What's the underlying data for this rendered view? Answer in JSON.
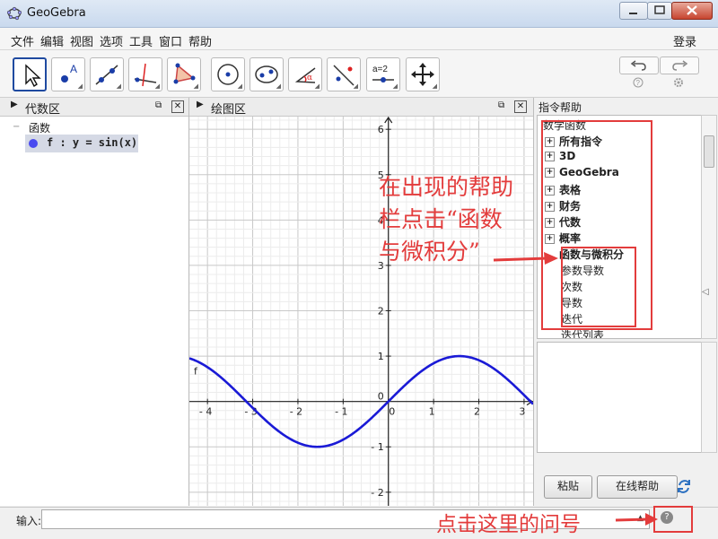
{
  "window": {
    "title": "GeoGebra"
  },
  "menu": [
    "文件",
    "编辑",
    "视图",
    "选项",
    "工具",
    "窗口",
    "帮助"
  ],
  "login": "登录",
  "toolbar": {
    "tool_8_label": "a=2"
  },
  "algebra": {
    "title": "代数区",
    "group": "函数",
    "item": "f : y = sin(x)",
    "item_color": "#4a4af0"
  },
  "graphics": {
    "title": "绘图区",
    "function_label": "f",
    "curve_color": "#1a1ad6"
  },
  "help": {
    "title": "指令帮助",
    "items": [
      "数学函数",
      "所有指令",
      "3D",
      "GeoGebra",
      "表格",
      "财务",
      "代数",
      "概率",
      "函数与微积分",
      "参数导数",
      "次数",
      "导数",
      "迭代",
      "迭代列表"
    ],
    "paste_button": "粘贴",
    "online_help_button": "在线帮助"
  },
  "input": {
    "label": "输入:"
  },
  "annotations": {
    "help_note": [
      "在出现的帮助",
      "栏点击“函数",
      "与微积分”"
    ],
    "bottom_note": "点击这里的问号",
    "color": "#e33c3c"
  },
  "chart_data": {
    "type": "line",
    "series": [
      {
        "name": "f",
        "function": "y = sin(x)",
        "color": "#1a1ad6"
      }
    ],
    "xlim": [
      -4.4,
      3.2
    ],
    "ylim": [
      -2.3,
      6.3
    ],
    "x_ticks": [
      -4,
      -3,
      -2,
      -1,
      0,
      1,
      2,
      3
    ],
    "y_ticks": [
      -2,
      -1,
      0,
      1,
      2,
      3,
      4,
      5,
      6
    ],
    "grid": true
  }
}
